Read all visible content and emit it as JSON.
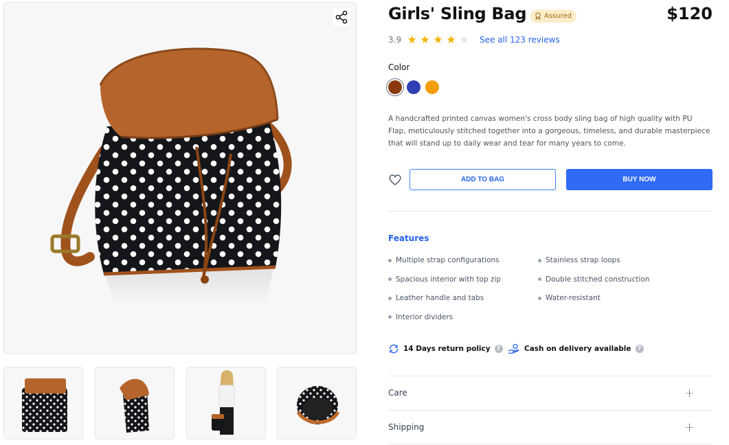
{
  "product": {
    "title": "Girls' Sling Bag",
    "badge": "Assured",
    "price": "$120",
    "rating": "3.9",
    "rating_stars": 4,
    "rating_max": 5,
    "reviews_link": "See all 123 reviews",
    "color_label": "Color",
    "colors": [
      "#8b3a0f",
      "#2f3fb4",
      "#f59e0b"
    ],
    "selected_color_index": 0,
    "description": "A handcrafted printed canvas women's cross body sling bag of high quality with PU Flap, meticulously stitched together into a gorgeous, timeless, and durable masterpiece that will stand up to daily wear and tear for many years to come."
  },
  "actions": {
    "add_to_bag": "ADD TO BAG",
    "buy_now": "BUY NOW"
  },
  "features": {
    "title": "Features",
    "left": [
      "Multiple strap configurations",
      "Spacious interior with top zip",
      "Leather handle and tabs",
      "Interior dividers"
    ],
    "right": [
      "Stainless strap loops",
      "Double stitched construction",
      "Water-resistant"
    ]
  },
  "policies": {
    "return": "14 Days return policy",
    "cod": "Cash on delivery available"
  },
  "accordions": {
    "care": "Care",
    "shipping": "Shipping"
  },
  "colors": {
    "accent": "#2563eb",
    "buy_button": "#2f6bf4",
    "star_filled": "#f5b301",
    "star_empty": "#e5e7eb"
  }
}
